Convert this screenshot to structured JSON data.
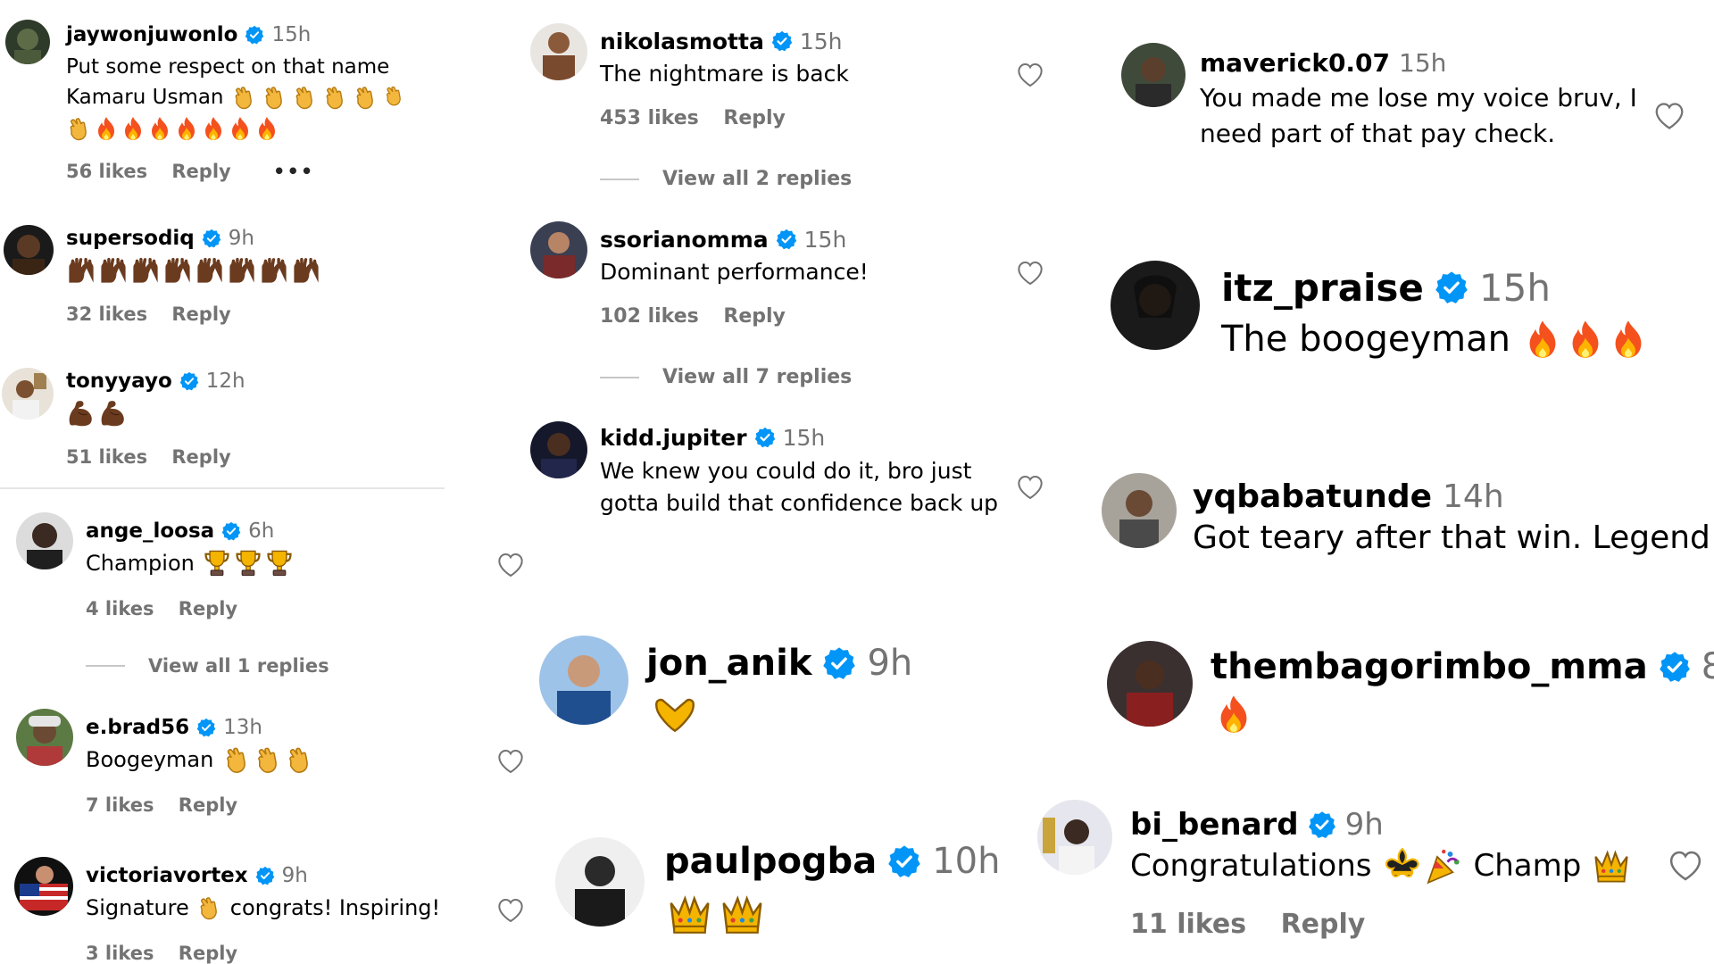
{
  "comments": [
    {
      "user": "jaywonjuwonlo",
      "time": "15h",
      "text": "Put some respect on that name",
      "text2": "Kamaru Usman",
      "emojis": "👏👏👏👏👏👏",
      "emojis2": "👏🔥🔥🔥🔥🔥🔥🔥",
      "likes": "56 likes",
      "reply": "Reply",
      "more": "•••"
    },
    {
      "user": "supersodiq",
      "time": "9h",
      "emojis": "🙌🙌🙌🙌🙌🙌🙌🙌",
      "likes": "32 likes",
      "reply": "Reply"
    },
    {
      "user": "tonyyayo",
      "time": "12h",
      "emojis": "💪💪",
      "likes": "51 likes",
      "reply": "Reply"
    },
    {
      "user": "ange_loosa",
      "time": "6h",
      "text": "Champion",
      "emojis": "🏆🏆🏆",
      "likes": "4 likes",
      "reply": "Reply",
      "view_replies": "View all 1 replies"
    },
    {
      "user": "e.brad56",
      "time": "13h",
      "text": "Boogeyman",
      "emojis": "👏👏👏",
      "likes": "7 likes",
      "reply": "Reply"
    },
    {
      "user": "victoriavortex",
      "time": "9h",
      "text": "Signature",
      "emoji_mid": "👏",
      "text2": "congrats! Inspiring!",
      "likes": "3 likes",
      "reply": "Reply"
    },
    {
      "user": "nikolasmotta",
      "time": "15h",
      "text": "The nightmare is back",
      "likes": "453 likes",
      "reply": "Reply",
      "view_replies": "View all 2 replies"
    },
    {
      "user": "ssorianomma",
      "time": "15h",
      "text": "Dominant performance!",
      "likes": "102 likes",
      "reply": "Reply",
      "view_replies": "View all 7 replies"
    },
    {
      "user": "kidd.jupiter",
      "time": "15h",
      "text": "We knew you could do it, bro just",
      "text2": "gotta build that confidence back up"
    },
    {
      "user": "jon_anik",
      "time": "9h",
      "emojis": "🫶"
    },
    {
      "user": "paulpogba",
      "time": "10h",
      "emojis": "👑👑"
    },
    {
      "user": "maverick0.07",
      "time": "15h",
      "text": "You made me lose my voice bruv, I",
      "text2": "need part of that pay check."
    },
    {
      "user": "itz_praise",
      "time": "15h",
      "text": "The boogeyman",
      "emojis": "🔥🔥🔥"
    },
    {
      "user": "yqbabatunde",
      "time": "14h",
      "text": "Got teary after that win. Legend",
      "emojis": "❤️"
    },
    {
      "user": "thembagorimbo_mma",
      "time": "8h",
      "emojis": "🔥"
    },
    {
      "user": "bi_benard",
      "time": "9h",
      "text": "Congratulations",
      "emojis": "⚜️🎉",
      "text2": "Champ",
      "emojis2": "👑",
      "likes": "11 likes",
      "reply": "Reply"
    }
  ],
  "colors": {
    "verified": "#0095f6",
    "muted": "#737373",
    "heart_stroke": "#737373"
  }
}
